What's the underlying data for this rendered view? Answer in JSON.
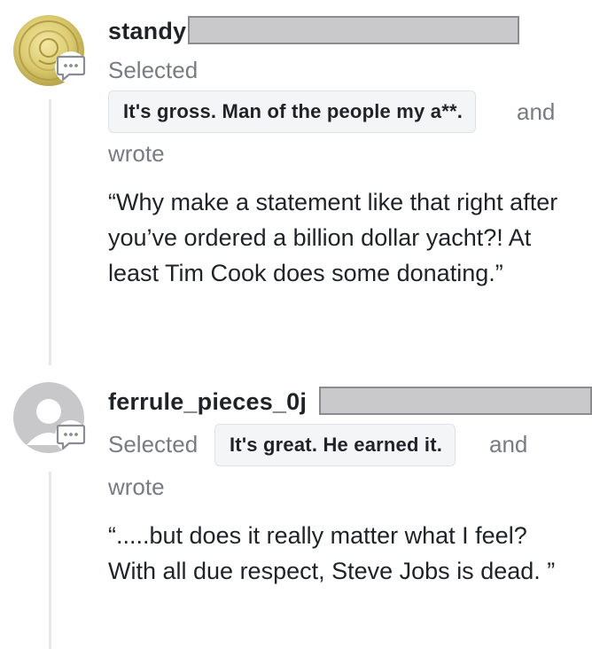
{
  "comments": [
    {
      "avatar": "coin-avatar",
      "username": "standy",
      "selected_label": "Selected",
      "choice": "It's gross. Man of the people my a**.",
      "and_label": "and",
      "wrote_label": "wrote",
      "quote": "“Why make a statement like that right after you’ve ordered a billion dollar yacht?! At least Tim Cook does some donating.”"
    },
    {
      "avatar": "default-user-avatar",
      "username": "ferrule_pieces_0j",
      "selected_label": "Selected",
      "choice": "It's great. He earned it.",
      "and_label": "and",
      "wrote_label": "wrote",
      "quote": "“.....but does it really matter what I feel? With all due respect, Steve Jobs is dead. ”"
    }
  ],
  "colors": {
    "thread_line": "#e6e7ea",
    "muted_text": "#787c82",
    "pill_bg": "#f4f5f7",
    "coin_gold": "#d9c56a",
    "default_avatar": "#c8c8ca"
  }
}
